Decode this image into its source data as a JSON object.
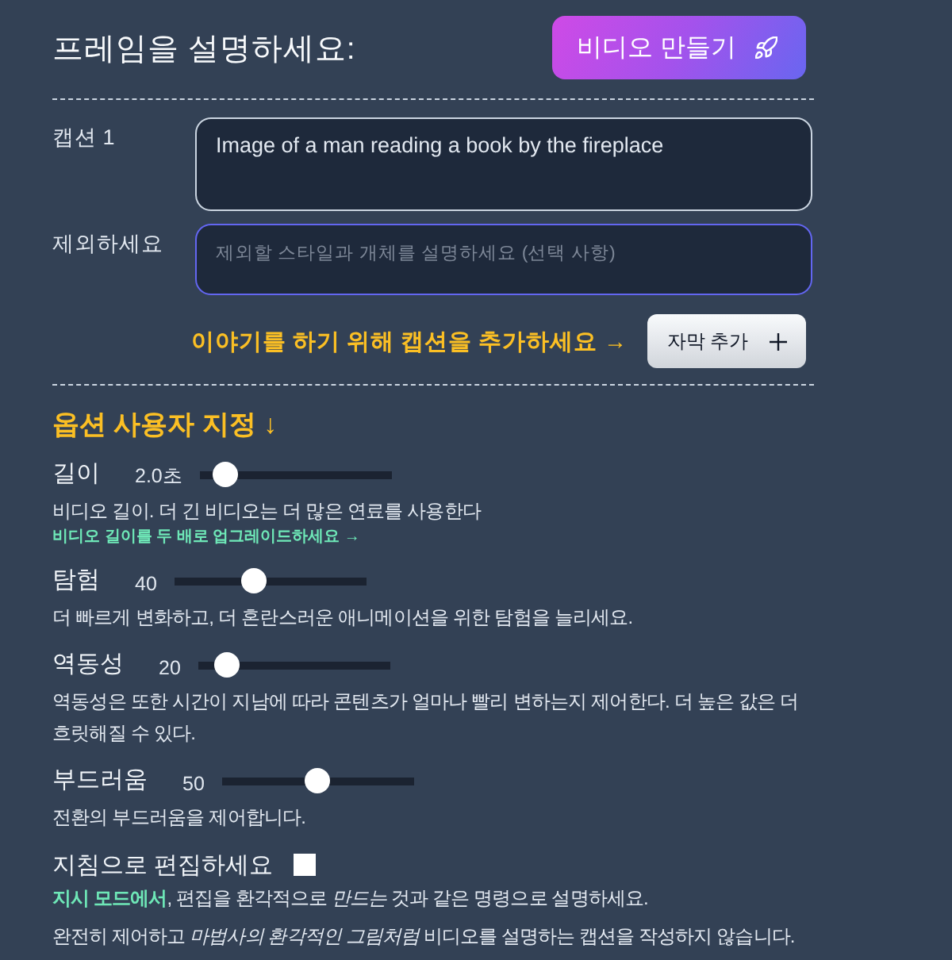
{
  "header": {
    "title": "프레임을 설명하세요:",
    "create_button": {
      "label": "비디오 만들기"
    }
  },
  "captions": [
    {
      "label": "캡션 1",
      "value": "Image of a man reading a book by the fireplace"
    }
  ],
  "exclude": {
    "label": "제외하세요",
    "placeholder": "제외할 스타일과 개체를 설명하세요 (선택 사항)",
    "focused": true
  },
  "add_caption": {
    "hint": "이야기를 하기 위해 캡션을 추가하세요 →",
    "button": "자막 추가"
  },
  "options": {
    "title": "옵션 사용자 지정 ↓",
    "sliders": [
      {
        "label": "길이",
        "reading": "2.0초",
        "level": 0.07,
        "description": "비디오 길이. 더 긴 비디오는 더 많은 연료를 사용한다",
        "link": "비디오 길이를 두 배로 업그레이드하세요 →"
      },
      {
        "label": "탐험",
        "reading": "40",
        "level": 0.4,
        "description": "더 빠르게 변화하고, 더 혼란스러운 애니메이션을 위한 탐험을 늘리세요."
      },
      {
        "label": "역동성",
        "reading": "20",
        "level": 0.1,
        "description": "역동성은 또한 시간이 지남에 따라 콘텐츠가 얼마나 빨리 변하는지 제어한다. 더 높은 값은 더 흐릿해질 수 있다."
      },
      {
        "label": "부드러움",
        "reading": "50",
        "level": 0.5,
        "description": "전환의 부드러움을 제어합니다."
      }
    ]
  },
  "instruct": {
    "label": "지침으로 편집하세요",
    "checked": false,
    "notes": [
      "**지시 모드에서**, 편집을 환각적으로 *만드는* 것과 같은 명령으로 설명하세요.",
      "완전히 제어하고 *마법사의 환각적인 그림처럼* 비디오를 설명하는 캡션을 작성하지 않습니다."
    ]
  }
}
